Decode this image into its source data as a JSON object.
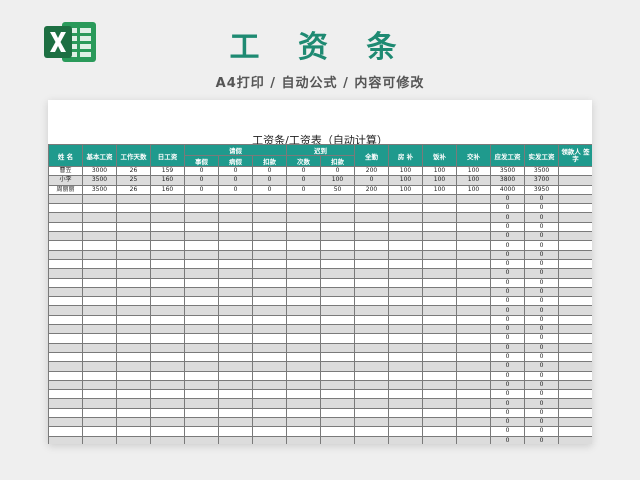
{
  "header": {
    "title": "工 资 条",
    "subtitle": "A4打印 / 自动公式 / 内容可修改"
  },
  "sheet": {
    "title": "工资条/工资表（自动计算）",
    "columns_top": [
      "姓 名",
      "基本工资",
      "工作天数",
      "日工资",
      "请假",
      "迟到",
      "全勤",
      "房 补",
      "饭补",
      "交补",
      "应发工资",
      "实发工资",
      "领款人 签 字"
    ],
    "columns_sub": [
      "事假",
      "病假",
      "扣款",
      "次数",
      "扣款"
    ],
    "rows": [
      [
        "曹笠",
        "3000",
        "26",
        "159",
        "0",
        "0",
        "0",
        "0",
        "0",
        "200",
        "100",
        "100",
        "100",
        "3500",
        "3500",
        ""
      ],
      [
        "小李",
        "3500",
        "25",
        "160",
        "0",
        "0",
        "0",
        "0",
        "100",
        "0",
        "100",
        "100",
        "100",
        "3800",
        "3700",
        ""
      ],
      [
        "周丽丽",
        "3500",
        "26",
        "160",
        "0",
        "0",
        "0",
        "0",
        "50",
        "200",
        "100",
        "100",
        "100",
        "4000",
        "3950",
        ""
      ]
    ],
    "empty_row_count": 27,
    "empty_row_values": [
      "0",
      "0"
    ]
  },
  "colors": {
    "accent": "#1e8a72",
    "header_bg": "#1f9a8d",
    "stripe": "#dcdcdc",
    "excel_green": "#1d6f42"
  }
}
